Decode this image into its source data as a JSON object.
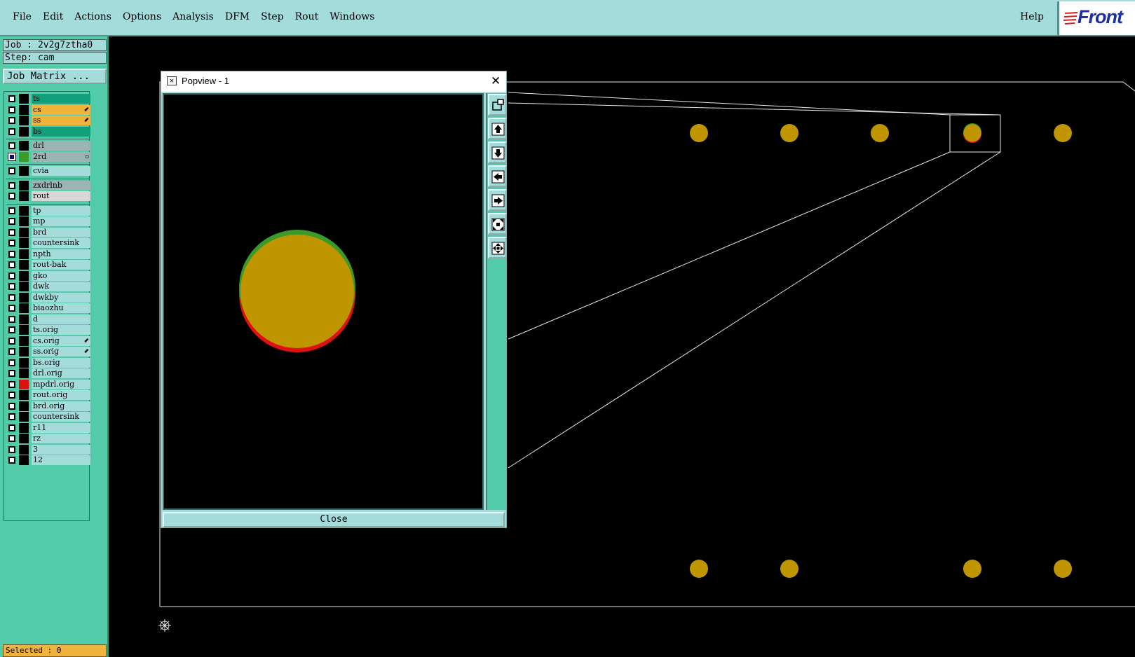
{
  "menubar": {
    "items": [
      "File",
      "Edit",
      "Actions",
      "Options",
      "Analysis",
      "DFM",
      "Step",
      "Rout",
      "Windows"
    ],
    "help": "Help",
    "logo": "Front"
  },
  "job": {
    "job_line": "Job : 2v2g7ztha0",
    "step_line": "Step: cam",
    "matrix_button": "Job Matrix ..."
  },
  "layers": [
    {
      "name": "ts",
      "color": "#12a07c",
      "swatch": "#000000"
    },
    {
      "name": "cs",
      "color": "#f0b43c",
      "swatch": "#000000",
      "mark": "⬋"
    },
    {
      "name": "ss",
      "color": "#f0b43c",
      "swatch": "#000000",
      "mark": "⬋"
    },
    {
      "name": "bs",
      "color": "#12a07c",
      "swatch": "#000000"
    },
    {
      "name": "drl",
      "color": "#9cb4b4",
      "swatch": "#000000"
    },
    {
      "name": "2rd",
      "color": "#9cb4b4",
      "swatch": "#3a9a2a",
      "mark": "▫",
      "checked": true
    },
    {
      "name": "cvia",
      "color": "#a4dcdc",
      "swatch": "#000000"
    },
    {
      "name": "zxdrlnb",
      "color": "#9cb4b4",
      "swatch": "#000000"
    },
    {
      "name": "rout",
      "color": "#d8d8d8",
      "swatch": "#000000"
    },
    {
      "name": "tp",
      "color": "#a4dcdc",
      "swatch": "#000000"
    },
    {
      "name": "mp",
      "color": "#a4dcdc",
      "swatch": "#000000"
    },
    {
      "name": "brd",
      "color": "#a4dcdc",
      "swatch": "#000000"
    },
    {
      "name": "countersink",
      "color": "#a4dcdc",
      "swatch": "#000000"
    },
    {
      "name": "npth",
      "color": "#a4dcdc",
      "swatch": "#000000"
    },
    {
      "name": "rout-bak",
      "color": "#a4dcdc",
      "swatch": "#000000"
    },
    {
      "name": "gko",
      "color": "#a4dcdc",
      "swatch": "#000000"
    },
    {
      "name": "dwk",
      "color": "#a4dcdc",
      "swatch": "#000000"
    },
    {
      "name": "dwkby",
      "color": "#a4dcdc",
      "swatch": "#000000"
    },
    {
      "name": "biaozhu",
      "color": "#a4dcdc",
      "swatch": "#000000"
    },
    {
      "name": "d",
      "color": "#a4dcdc",
      "swatch": "#000000"
    },
    {
      "name": "ts.orig",
      "color": "#a4dcdc",
      "swatch": "#000000"
    },
    {
      "name": "cs.orig",
      "color": "#a4dcdc",
      "swatch": "#000000",
      "mark": "⬋"
    },
    {
      "name": "ss.orig",
      "color": "#a4dcdc",
      "swatch": "#000000",
      "mark": "⬋"
    },
    {
      "name": "bs.orig",
      "color": "#a4dcdc",
      "swatch": "#000000"
    },
    {
      "name": "drl.orig",
      "color": "#a4dcdc",
      "swatch": "#000000"
    },
    {
      "name": "mpdrl.orig",
      "color": "#a4dcdc",
      "swatch": "#e01010"
    },
    {
      "name": "rout.orig",
      "color": "#a4dcdc",
      "swatch": "#000000"
    },
    {
      "name": "brd.orig",
      "color": "#a4dcdc",
      "swatch": "#000000"
    },
    {
      "name": "countersink",
      "color": "#a4dcdc",
      "swatch": "#000000"
    },
    {
      "name": "r11",
      "color": "#a4dcdc",
      "swatch": "#000000"
    },
    {
      "name": "rz",
      "color": "#a4dcdc",
      "swatch": "#000000"
    },
    {
      "name": "3",
      "color": "#a4dcdc",
      "swatch": "#000000"
    },
    {
      "name": "12",
      "color": "#a4dcdc",
      "swatch": "#000000"
    }
  ],
  "status": {
    "selected": "Selected : 0"
  },
  "popview": {
    "title": "Popview - 1",
    "close_label": "Close",
    "tools": [
      "zoom-window-icon",
      "pan-up-icon",
      "pan-down-icon",
      "pan-left-icon",
      "pan-right-icon",
      "zoom-fit-icon",
      "zoom-home-icon"
    ]
  },
  "colors": {
    "pad": "#c09600",
    "pad_top_layer": "#3a9a2a",
    "pad_bottom_layer": "#e01010",
    "panel": "#52cca8",
    "menubar": "#a4dcdc"
  }
}
